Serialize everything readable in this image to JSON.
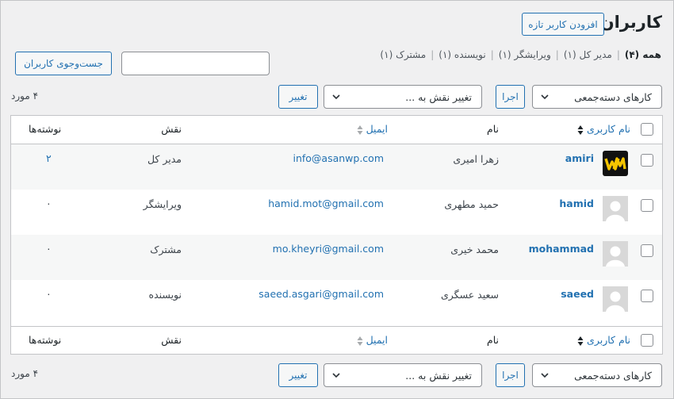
{
  "page": {
    "title": "کاربران",
    "add_new_label": "افزودن کاربر تازه"
  },
  "filters": [
    {
      "label": "همه",
      "count": "(۴)",
      "current": true
    },
    {
      "label": "مدیر کل",
      "count": "(۱)"
    },
    {
      "label": "ویرایشگر",
      "count": "(۱)"
    },
    {
      "label": "نویسنده",
      "count": "(۱)"
    },
    {
      "label": "مشترک",
      "count": "(۱)"
    }
  ],
  "search": {
    "value": "",
    "button_label": "جست‌وجوی کاربران"
  },
  "tablenav": {
    "bulk_actions_label": "کارهای دسته‌جمعی",
    "apply_label": "اجرا",
    "change_role_label": "تغییر نقش به ...",
    "change_label": "تغییر",
    "count_label": "۴ مورد"
  },
  "columns": {
    "username": "نام کاربری",
    "name": "نام",
    "email": "ایمیل",
    "role": "نقش",
    "posts": "نوشته‌ها"
  },
  "users": [
    {
      "username": "amiri",
      "name": "زهرا امیری",
      "email": "info@asanwp.com",
      "role": "مدیر کل",
      "posts": "۲",
      "avatar": "logo"
    },
    {
      "username": "hamid",
      "name": "حمید مطهری",
      "email": "hamid.mot@gmail.com",
      "role": "ویرایشگر",
      "posts": "۰",
      "avatar": "default"
    },
    {
      "username": "mohammad",
      "name": "محمد خیری",
      "email": "mo.kheyri@gmail.com",
      "role": "مشترک",
      "posts": "۰",
      "avatar": "default"
    },
    {
      "username": "saeed",
      "name": "سعید عسگری",
      "email": "saeed.asgari@gmail.com",
      "role": "نویسنده",
      "posts": "۰",
      "avatar": "default"
    }
  ],
  "colors": {
    "accent": "#2271b1",
    "background": "#f0f0f1",
    "logo_bg": "#111111",
    "logo_fg": "#f5c400"
  }
}
